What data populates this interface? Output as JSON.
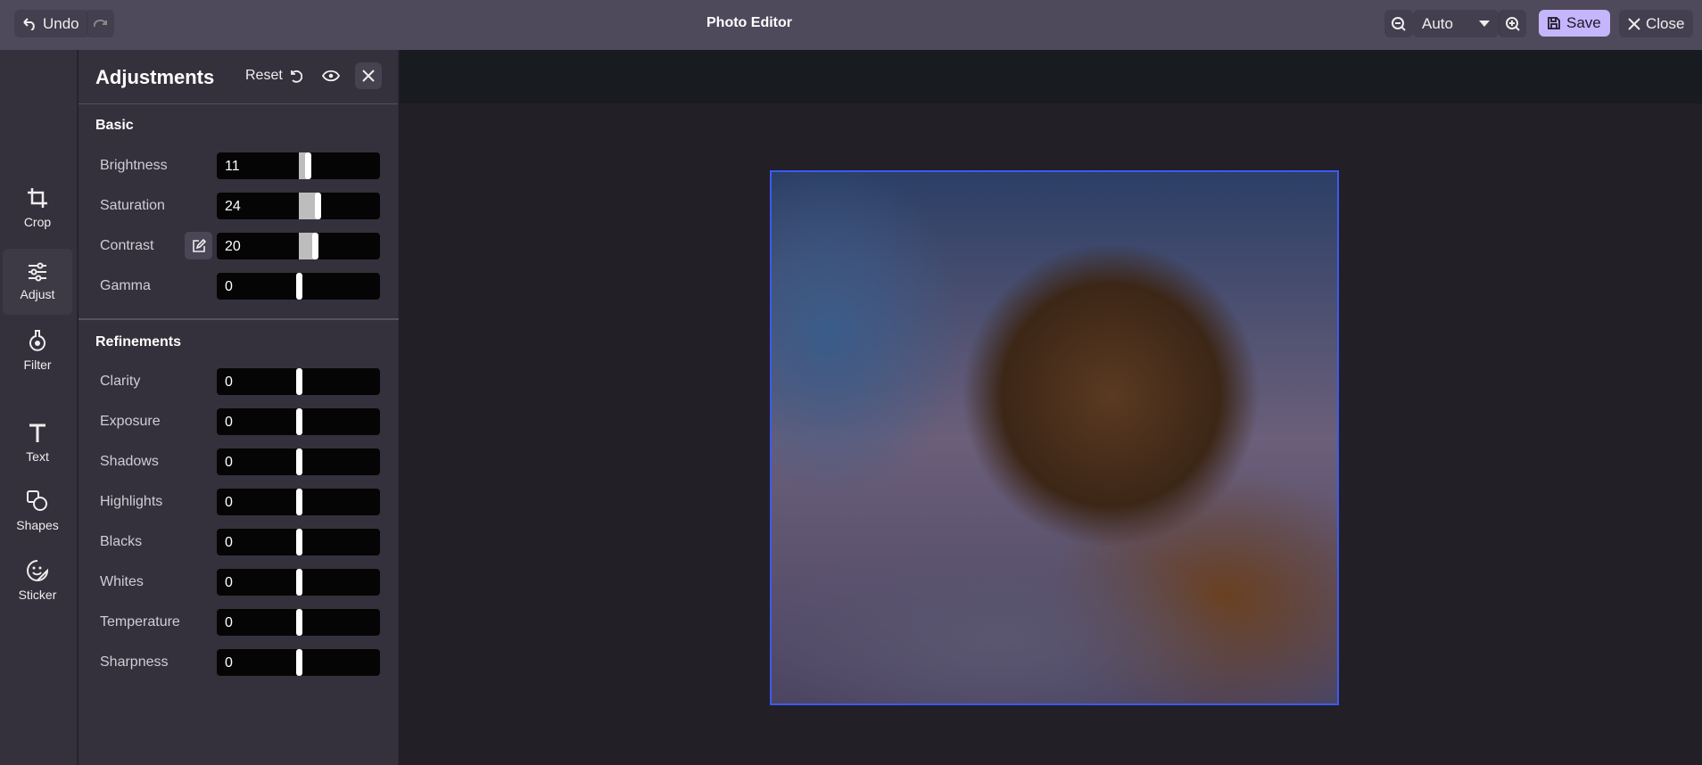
{
  "topbar": {
    "undo": "Undo",
    "title": "Photo Editor",
    "zoom": "Auto",
    "save": "Save",
    "close": "Close"
  },
  "rail": [
    {
      "label": "Crop",
      "icon": "crop-icon"
    },
    {
      "label": "Adjust",
      "icon": "sliders-icon"
    },
    {
      "label": "Filter",
      "icon": "flask-icon"
    },
    {
      "label": "Text",
      "icon": "text-icon"
    },
    {
      "label": "Shapes",
      "icon": "shapes-icon"
    },
    {
      "label": "Sticker",
      "icon": "sticker-icon"
    }
  ],
  "panel": {
    "title": "Adjustments",
    "reset": "Reset",
    "basic": {
      "heading": "Basic",
      "rows": [
        {
          "label": "Brightness",
          "value": 11
        },
        {
          "label": "Saturation",
          "value": 24
        },
        {
          "label": "Contrast",
          "value": 20
        },
        {
          "label": "Gamma",
          "value": 0
        }
      ]
    },
    "refinements": {
      "heading": "Refinements",
      "rows": [
        {
          "label": "Clarity",
          "value": 0
        },
        {
          "label": "Exposure",
          "value": 0
        },
        {
          "label": "Shadows",
          "value": 0
        },
        {
          "label": "Highlights",
          "value": 0
        },
        {
          "label": "Blacks",
          "value": 0
        },
        {
          "label": "Whites",
          "value": 0
        },
        {
          "label": "Temperature",
          "value": 0
        },
        {
          "label": "Sharpness",
          "value": 0
        }
      ]
    },
    "slider_range": [
      -100,
      100
    ]
  },
  "colors": {
    "accent": "#c4b5fd",
    "selection": "#3d5af1"
  }
}
